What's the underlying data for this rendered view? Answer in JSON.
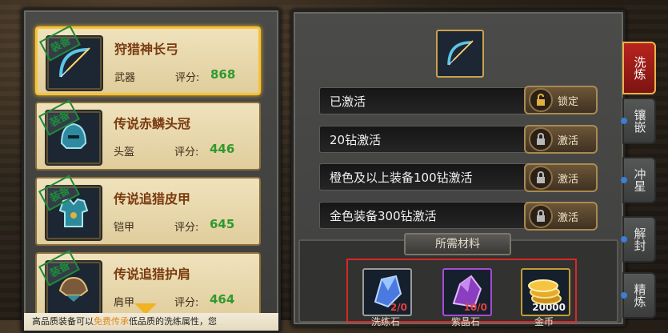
{
  "items": [
    {
      "name": "狩猎神长弓",
      "type": "武器",
      "score_label": "评分:",
      "score": "868",
      "stamp": "装备"
    },
    {
      "name": "传说赤鳞头冠",
      "type": "头盔",
      "score_label": "评分:",
      "score": "446",
      "stamp": "装备"
    },
    {
      "name": "传说追猎皮甲",
      "type": "铠甲",
      "score_label": "评分:",
      "score": "645",
      "stamp": "装备"
    },
    {
      "name": "传说追猎护肩",
      "type": "肩甲",
      "score_label": "评分:",
      "score": "464",
      "stamp": "装备"
    }
  ],
  "tooltip": {
    "prefix": "高品质装备可以",
    "highlight": "免费传承",
    "suffix": "低品质的洗练属性，您"
  },
  "stats": [
    {
      "label": "已激活",
      "button": "锁定"
    },
    {
      "label": "20钻激活",
      "button": "激活"
    },
    {
      "label": "橙色及以上装备100钻激活",
      "button": "激活"
    },
    {
      "label": "金色装备300钻激活",
      "button": "激活"
    }
  ],
  "materials": {
    "header": "所需材料",
    "slots": [
      {
        "count": "2/0",
        "name": "洗练石"
      },
      {
        "count": "10/0",
        "name": "紫晶石"
      },
      {
        "count": "20000",
        "name": "金币"
      }
    ]
  },
  "tabs": [
    {
      "label": "洗炼"
    },
    {
      "label": "镶嵌"
    },
    {
      "label": "冲星"
    },
    {
      "label": "解封"
    },
    {
      "label": "精炼"
    }
  ],
  "colors": {
    "accent": "#f7c234",
    "score": "#2e9a2e",
    "active_tab": "#b8241f"
  }
}
